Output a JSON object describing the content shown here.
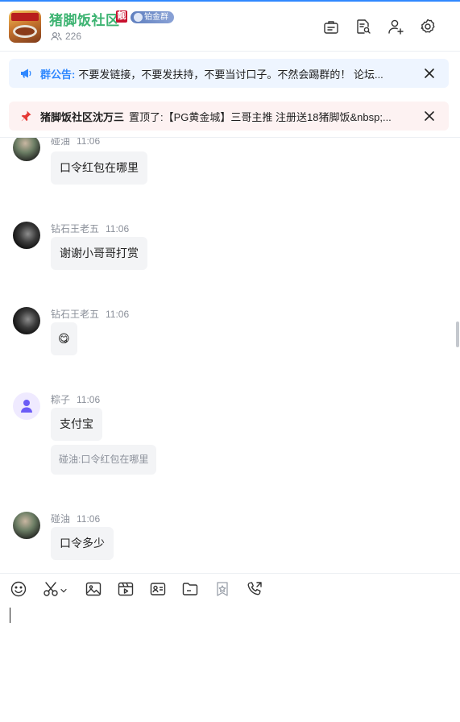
{
  "header": {
    "group_name": "猪脚饭社区",
    "badge_liang": "靓",
    "badge_level": "铂金群",
    "member_count": "226",
    "icons": [
      "announcement-icon",
      "chat-history-search-icon",
      "add-member-icon",
      "settings-icon"
    ]
  },
  "notice": {
    "label": "群公告:",
    "text": "不要发链接，不要发扶持，不要当讨口子。不然会踢群的！ 论坛..."
  },
  "pinned": {
    "who": "猪脚饭社区沈万三",
    "text": "置顶了:【PG黄金城】三哥主推 注册送18猪脚饭&nbsp;..."
  },
  "messages": [
    {
      "sender": "碰油",
      "time": "11:06",
      "text": "口令红包在哪里"
    },
    {
      "sender": "钻石王老五",
      "time": "11:06",
      "text": "谢谢小哥哥打赏"
    },
    {
      "sender": "钻石王老五",
      "time": "11:06",
      "text": "😋"
    },
    {
      "sender": "粽子",
      "time": "11:06",
      "text": "支付宝",
      "quote_sender": "碰油:",
      "quote_text": "口令红包在哪里"
    },
    {
      "sender": "碰油",
      "time": "11:06",
      "text": "口令多少"
    }
  ],
  "toolbar_icons": [
    "emoji-icon",
    "scissors-icon",
    "image-icon",
    "video-icon",
    "contact-card-icon",
    "folder-icon",
    "favorite-icon",
    "voice-call-icon"
  ],
  "composer": {
    "value": ""
  },
  "colors": {
    "accent": "#2f88ff",
    "group_name": "#3cb371",
    "liang": "#c8102e",
    "pin": "#e53935"
  }
}
